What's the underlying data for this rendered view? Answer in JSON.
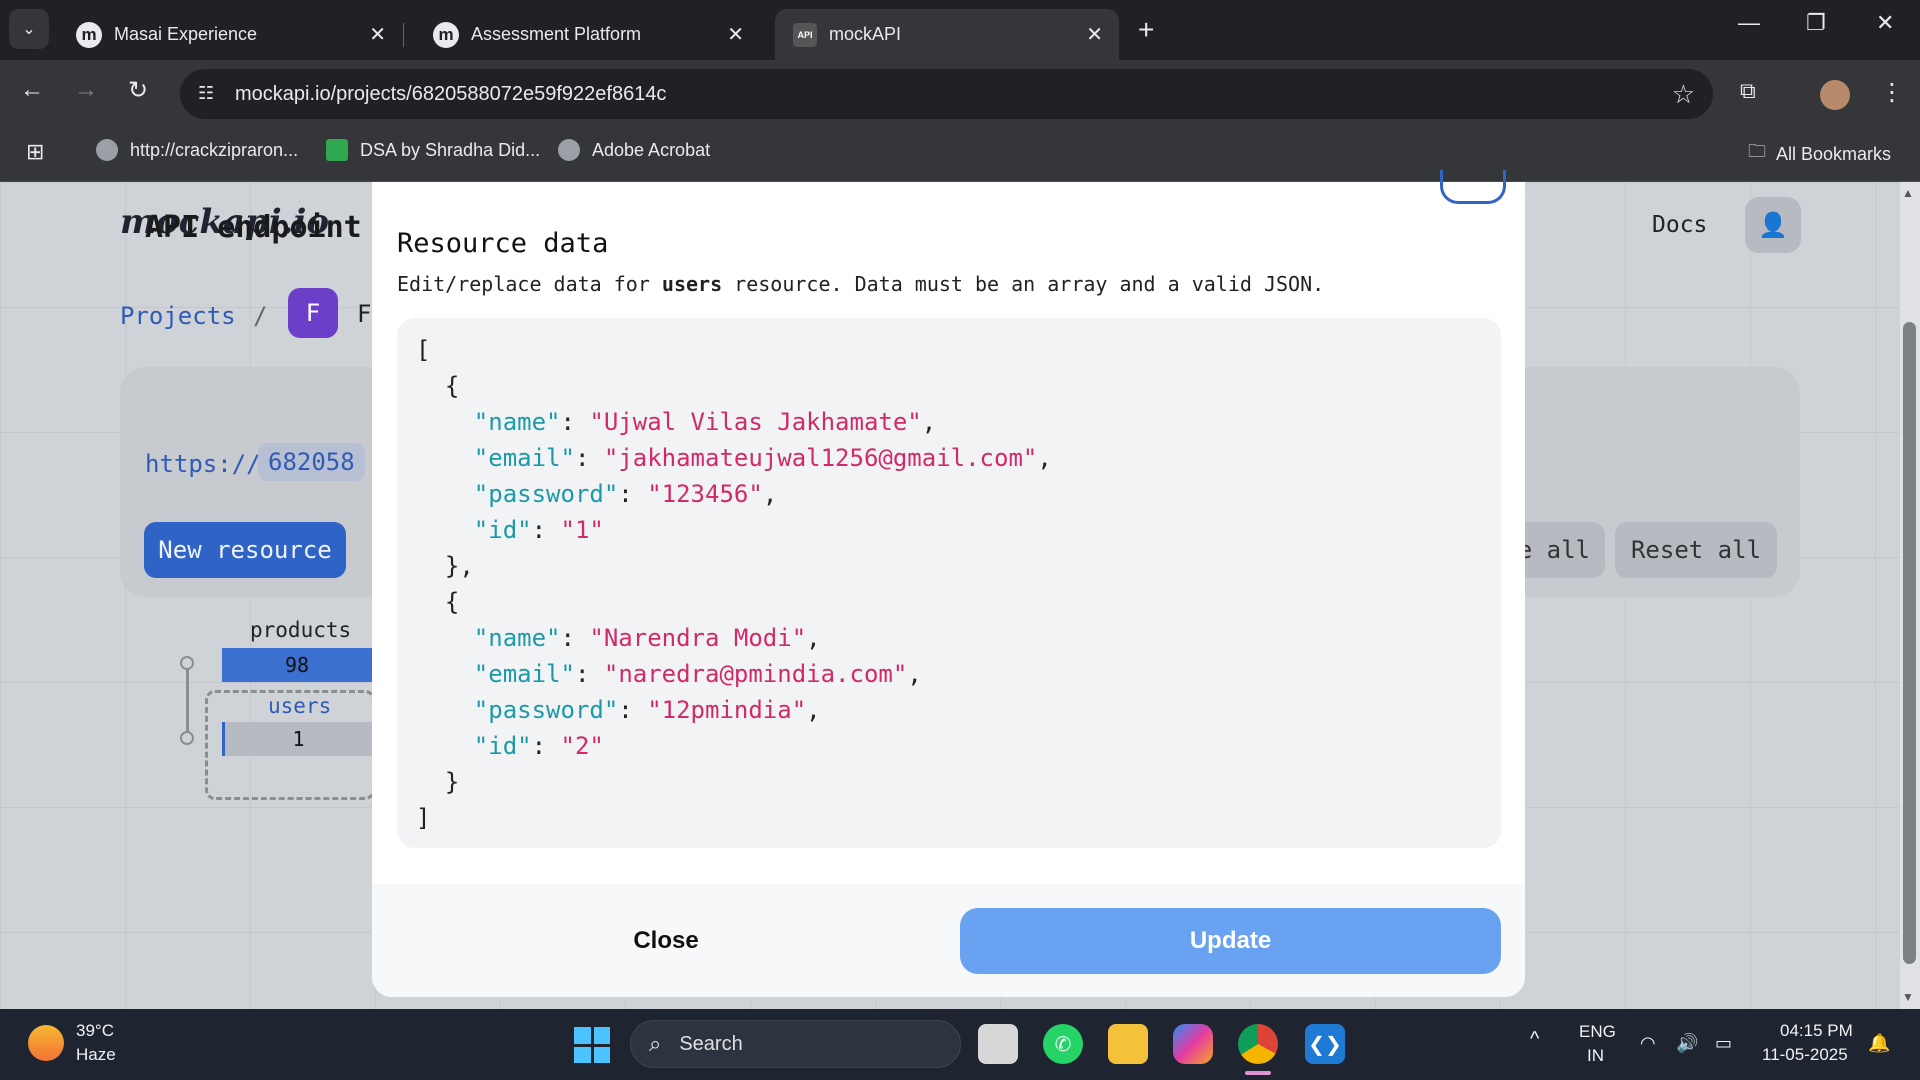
{
  "browser": {
    "tabs": [
      {
        "title": "Masai Experience",
        "favicon": "m"
      },
      {
        "title": "Assessment Platform",
        "favicon": "m"
      },
      {
        "title": "mockAPI",
        "favicon": "API"
      }
    ],
    "url": "mockapi.io/projects/6820588072e59f922ef8614c",
    "bookmarks": [
      "http://crackzipraron...",
      "DSA by Shradha Did...",
      "Adobe Acrobat"
    ],
    "all_bookmarks": "All Bookmarks"
  },
  "page": {
    "logo": "mockapi.io",
    "docs": "Docs",
    "breadcrumb_projects": "Projects",
    "breadcrumb_sep": "/",
    "project_initial": "F",
    "project_name_partial": "F",
    "card_title": "API endpoint",
    "endpoint_prefix": "https://",
    "endpoint_id_partial": "682058",
    "new_resource": "New resource",
    "generate_all_partial": "e all",
    "reset_all": "Reset all",
    "resources": [
      {
        "name": "products",
        "count": "98"
      },
      {
        "name": "users",
        "count": "1"
      }
    ]
  },
  "modal": {
    "title": "Resource data",
    "desc_before": "Edit/replace data for ",
    "desc_resource": "users",
    "desc_after": " resource. Data must be an array and a valid JSON.",
    "records": [
      {
        "name": "Ujwal Vilas Jakhamate",
        "email": "jakhamateujwal1256@gmail.com",
        "password": "123456",
        "id": "1"
      },
      {
        "name": "Narendra Modi",
        "email": "naredra@pmindia.com",
        "password": "12pmindia",
        "id": "2"
      }
    ],
    "close_label": "Close",
    "update_label": "Update"
  },
  "taskbar": {
    "temperature": "39°C",
    "weather": "Haze",
    "search": "Search",
    "lang": "ENG",
    "region": "IN",
    "time": "04:15 PM",
    "date": "11-05-2025"
  },
  "colors": {
    "accent": "#2f63c6",
    "update_button": "#6aa2f2",
    "json_key": "#1e9aa6",
    "json_string": "#d12a6a"
  }
}
